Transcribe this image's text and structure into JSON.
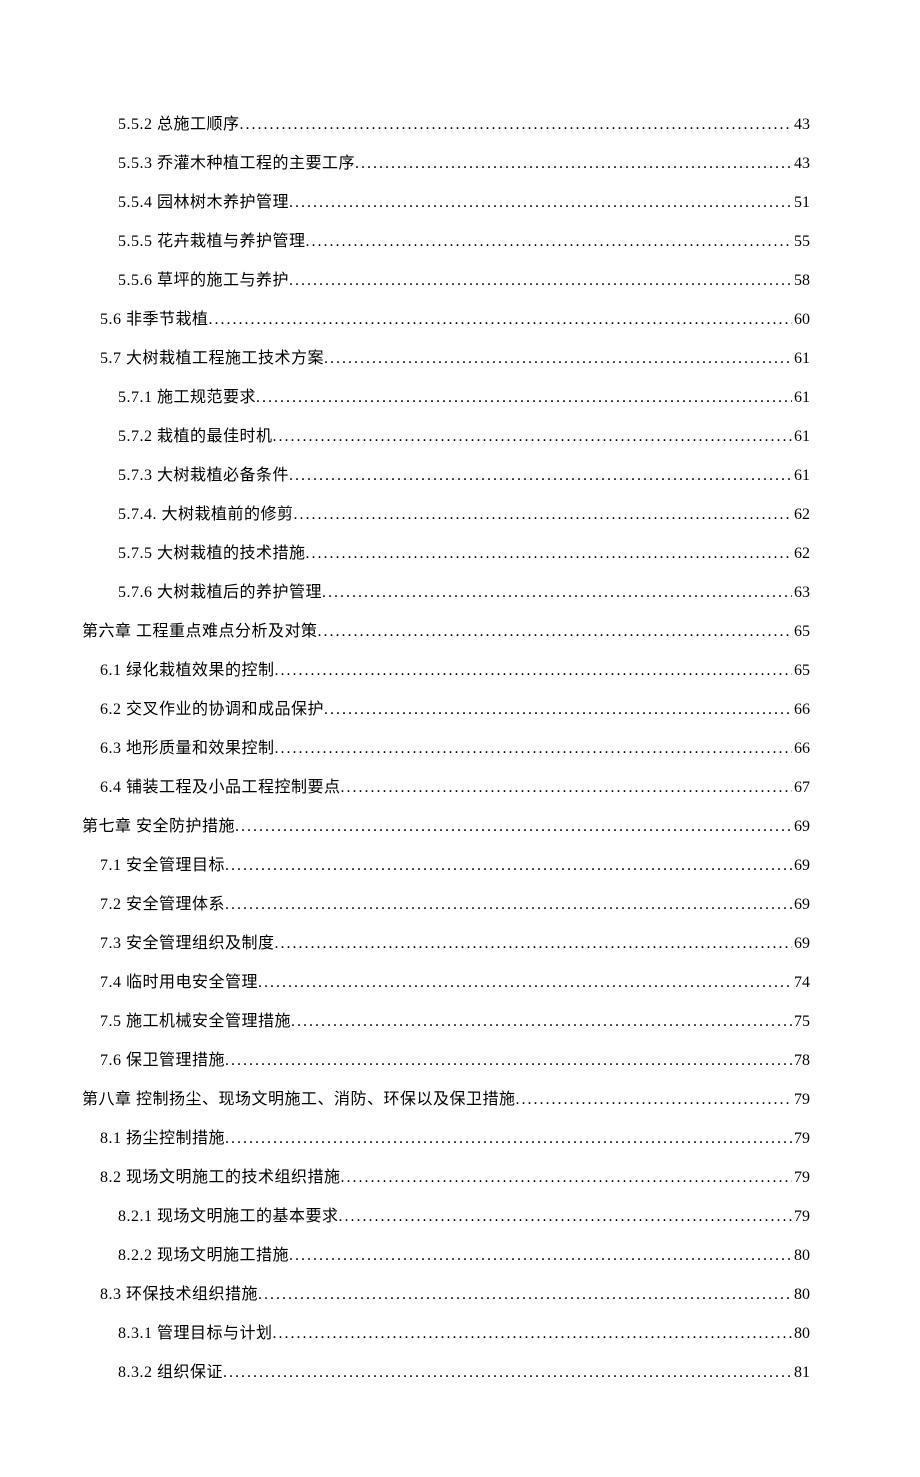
{
  "toc": [
    {
      "level": 3,
      "title": "5.5.2 总施工顺序",
      "page": "43"
    },
    {
      "level": 3,
      "title": "5.5.3 乔灌木种植工程的主要工序",
      "page": "43"
    },
    {
      "level": 3,
      "title": "5.5.4 园林树木养护管理",
      "page": "51"
    },
    {
      "level": 3,
      "title": "5.5.5 花卉栽植与养护管理",
      "page": "55"
    },
    {
      "level": 3,
      "title": "5.5.6 草坪的施工与养护",
      "page": "58"
    },
    {
      "level": 2,
      "title": "5.6 非季节栽植 ",
      "page": "60"
    },
    {
      "level": 2,
      "title": "5.7 大树栽植工程施工技术方案 ",
      "page": "61"
    },
    {
      "level": 3,
      "title": "5.7.1 施工规范要求",
      "page": "61"
    },
    {
      "level": 3,
      "title": "5.7.2 栽植的最佳时机",
      "page": "61"
    },
    {
      "level": 3,
      "title": "5.7.3 大树栽植必备条件",
      "page": "61"
    },
    {
      "level": 3,
      "title": "5.7.4. 大树栽植前的修剪 ",
      "page": "62"
    },
    {
      "level": 3,
      "title": "5.7.5 大树栽植的技术措施",
      "page": "62"
    },
    {
      "level": 3,
      "title": "5.7.6 大树栽植后的养护管理",
      "page": "63"
    },
    {
      "level": 1,
      "title": "第六章  工程重点难点分析及对策",
      "page": "65"
    },
    {
      "level": 2,
      "title": "6.1 绿化栽植效果的控制 ",
      "page": "65"
    },
    {
      "level": 2,
      "title": "6.2 交叉作业的协调和成品保护 ",
      "page": "66"
    },
    {
      "level": 2,
      "title": "6.3 地形质量和效果控制 ",
      "page": "66"
    },
    {
      "level": 2,
      "title": "6.4 铺装工程及小品工程控制要点 ",
      "page": "67"
    },
    {
      "level": 1,
      "title": "第七章  安全防护措施",
      "page": "69"
    },
    {
      "level": 2,
      "title": "7.1 安全管理目标 ",
      "page": "69"
    },
    {
      "level": 2,
      "title": "7.2 安全管理体系 ",
      "page": "69"
    },
    {
      "level": 2,
      "title": "7.3 安全管理组织及制度 ",
      "page": "69"
    },
    {
      "level": 2,
      "title": "7.4 临时用电安全管理 ",
      "page": "74"
    },
    {
      "level": 2,
      "title": "7.5 施工机械安全管理措施 ",
      "page": "75"
    },
    {
      "level": 2,
      "title": "7.6 保卫管理措施 ",
      "page": "78"
    },
    {
      "level": 1,
      "title": "第八章  控制扬尘、现场文明施工、消防、环保以及保卫措施",
      "page": "79"
    },
    {
      "level": 2,
      "title": "8.1 扬尘控制措施 ",
      "page": "79"
    },
    {
      "level": 2,
      "title": "8.2 现场文明施工的技术组织措施 ",
      "page": "79"
    },
    {
      "level": 3,
      "title": "8.2.1 现场文明施工的基本要求",
      "page": "79"
    },
    {
      "level": 3,
      "title": "8.2.2 现场文明施工措施",
      "page": "80"
    },
    {
      "level": 2,
      "title": "8.3 环保技术组织措施 ",
      "page": "80"
    },
    {
      "level": 3,
      "title": "8.3.1 管理目标与计划",
      "page": "80"
    },
    {
      "level": 3,
      "title": "8.3.2 组织保证",
      "page": "81"
    }
  ]
}
